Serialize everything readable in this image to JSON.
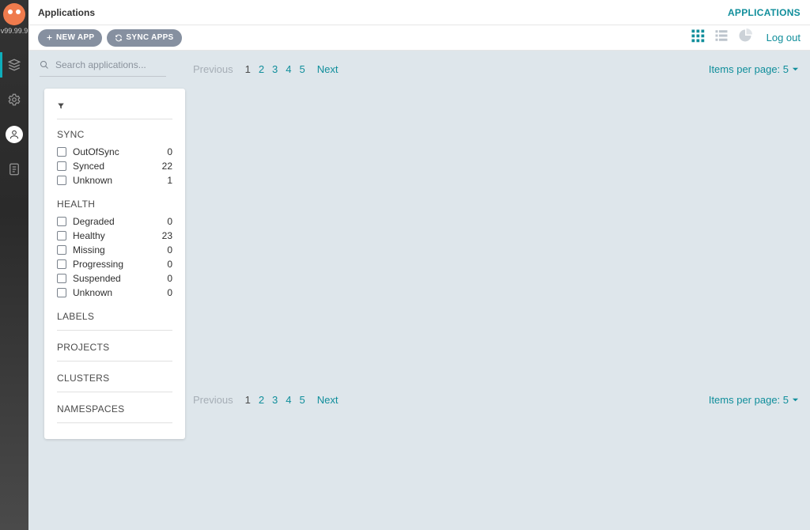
{
  "leftnav": {
    "version": "v99.99.9"
  },
  "topstrip": {
    "title": "Applications",
    "crumb": "APPLICATIONS"
  },
  "toolbar": {
    "new_app": "NEW APP",
    "sync_apps": "SYNC APPS",
    "logout": "Log out"
  },
  "search": {
    "placeholder": "Search applications..."
  },
  "pagination": {
    "prev": "Previous",
    "pages": [
      "1",
      "2",
      "3",
      "4",
      "5"
    ],
    "current": "1",
    "next": "Next",
    "items_per_page_label": "Items per page: 5"
  },
  "filter": {
    "sync_title": "SYNC",
    "sync_items": [
      {
        "label": "OutOfSync",
        "count": "0"
      },
      {
        "label": "Synced",
        "count": "22"
      },
      {
        "label": "Unknown",
        "count": "1"
      }
    ],
    "health_title": "HEALTH",
    "health_items": [
      {
        "label": "Degraded",
        "count": "0"
      },
      {
        "label": "Healthy",
        "count": "23"
      },
      {
        "label": "Missing",
        "count": "0"
      },
      {
        "label": "Progressing",
        "count": "0"
      },
      {
        "label": "Suspended",
        "count": "0"
      },
      {
        "label": "Unknown",
        "count": "0"
      }
    ],
    "labels_title": "LABELS",
    "projects_title": "PROJECTS",
    "clusters_title": "CLUSTERS",
    "namespaces_title": "NAMESPACES"
  }
}
